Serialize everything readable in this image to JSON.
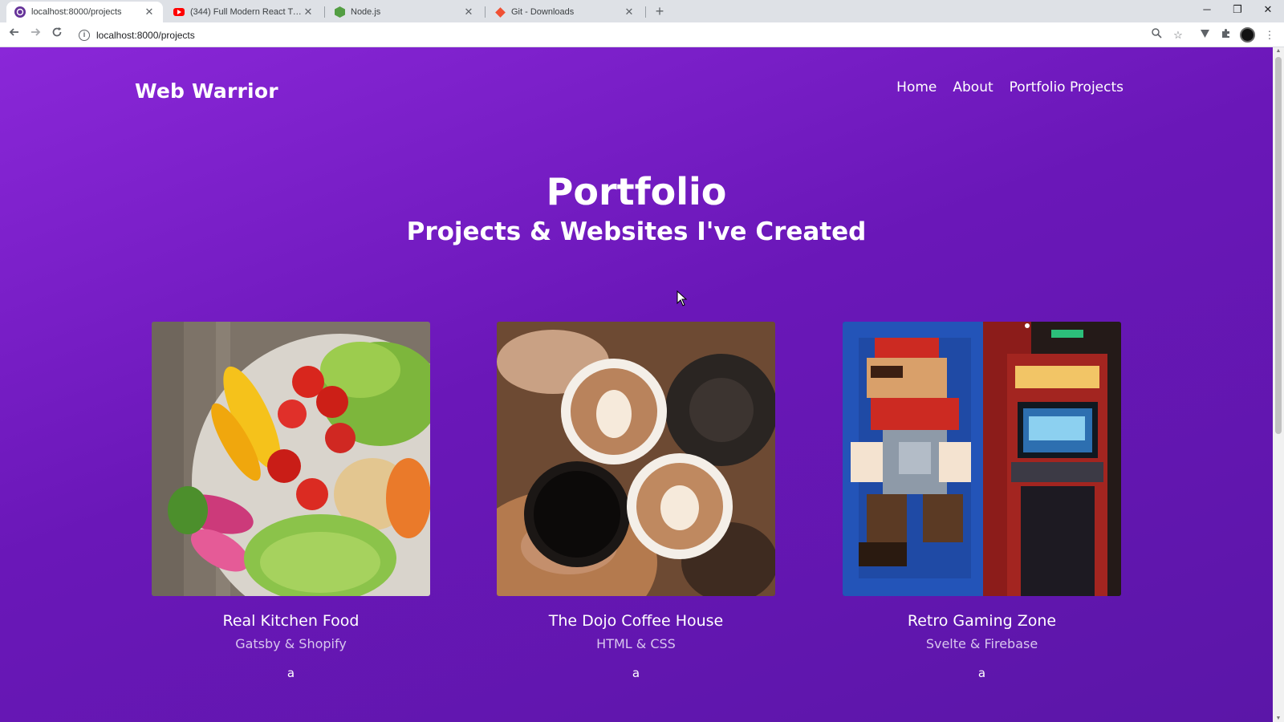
{
  "browser": {
    "tabs": [
      {
        "title": "localhost:8000/projects",
        "icon": "gatsby-icon",
        "active": true
      },
      {
        "title": "(344) Full Modern React Tutorial",
        "icon": "youtube-icon",
        "active": false
      },
      {
        "title": "Node.js",
        "icon": "nodejs-icon",
        "active": false
      },
      {
        "title": "Git - Downloads",
        "icon": "git-icon",
        "active": false
      }
    ],
    "address": "localhost:8000/projects"
  },
  "site": {
    "brand": "Web Warrior",
    "nav": [
      "Home",
      "About",
      "Portfolio Projects"
    ]
  },
  "hero": {
    "title": "Portfolio",
    "subtitle": "Projects & Websites I've Created"
  },
  "projects": [
    {
      "name": "Real Kitchen Food",
      "stack": "Gatsby & Shopify",
      "link": "a",
      "image": "salad-bowl-photo"
    },
    {
      "name": "The Dojo Coffee House",
      "stack": "HTML & CSS",
      "link": "a",
      "image": "coffee-cups-photo"
    },
    {
      "name": "Retro Gaming Zone",
      "stack": "Svelte & Firebase",
      "link": "a",
      "image": "arcade-mario-photo"
    }
  ],
  "colors": {
    "page_gradient_start": "#8a27d8",
    "page_gradient_end": "#5b16a8",
    "text": "#ffffff",
    "stack_text": "#d8c6ee"
  }
}
